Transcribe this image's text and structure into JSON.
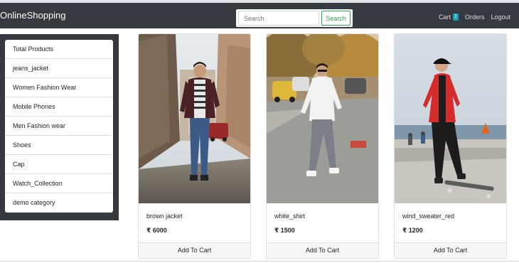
{
  "navbar": {
    "brand": "OnlineShopping",
    "search": {
      "placeholder": "Search",
      "value": "",
      "button_label": "Search"
    },
    "links": {
      "cart_label": "Cart",
      "cart_count": "1",
      "orders_label": "Orders",
      "logout_label": "Logout"
    }
  },
  "sidebar": {
    "categories": [
      "Total Products",
      "jeans_jacket",
      "Women Fashion Wear",
      "Mobile Phones",
      "Men Fashion wear",
      "Shoes",
      "Cap",
      "Watch_Collection",
      "demo category"
    ]
  },
  "products": [
    {
      "name": "brown jacket",
      "price": "₹ 6000",
      "button_label": "Add To Cart"
    },
    {
      "name": "white_shirt",
      "price": "₹ 1500",
      "button_label": "Add To Cart"
    },
    {
      "name": "wind_sweater_red",
      "price": "₹ 1200",
      "button_label": "Add To Cart"
    }
  ],
  "colors": {
    "navbar_bg": "#343a40",
    "search_button": "#28a745",
    "cart_badge": "#17a2b8"
  }
}
